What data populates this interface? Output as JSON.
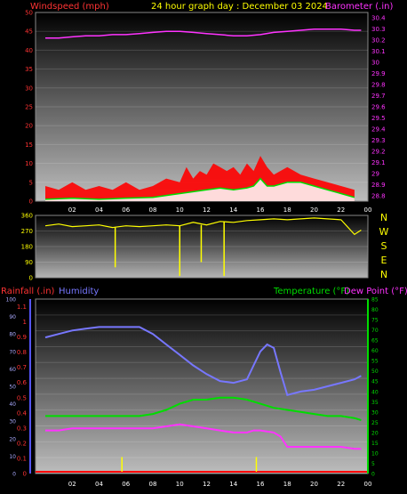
{
  "header": {
    "left_label": "Windspeed (mph)",
    "center_label": "24 hour graph day : December 03 2024",
    "right_label": "Barometer (.in)"
  },
  "bottom_header": {
    "rainfall_label": "Rainfall (.in)",
    "humidity_label": "Humidity",
    "temperature_label": "Temperature (°F)",
    "dewpoint_label": "Dew Point (°F)"
  },
  "direction_letters": [
    "N",
    "W",
    "S",
    "E",
    "N"
  ],
  "colors": {
    "wind": "#ff0000",
    "wind_avg": "#ffffff",
    "wind_green": "#00dd00",
    "barometer": "#ff33ff",
    "direction": "#ffff00",
    "humidity": "#7777ff",
    "temperature": "#00dd00",
    "dewpoint": "#ff33ff",
    "rain": "#ffff00",
    "axis_red": "#ff3333",
    "axis_pink": "#ff33ff",
    "axis_green": "#00dd00",
    "axis_blue": "#5555ff"
  },
  "chart_data": [
    {
      "type": "line",
      "x_ticks": [
        "02",
        "04",
        "06",
        "08",
        "10",
        "12",
        "14",
        "16",
        "18",
        "20",
        "22",
        "00"
      ],
      "y_left_ticks": [
        "0",
        "5",
        "10",
        "15",
        "20",
        "25",
        "30",
        "35",
        "40",
        "45",
        "50"
      ],
      "y_right_ticks": [
        "28.8",
        "28.9",
        "29",
        "29.1",
        "29.2",
        "29.3",
        "29.4",
        "29.5",
        "29.6",
        "29.7",
        "29.8",
        "29.9",
        "30",
        "30.1",
        "30.2",
        "30.3",
        "30.4"
      ],
      "ylim_left": [
        0,
        50
      ],
      "ylim_right": [
        28.75,
        30.45
      ],
      "series": [
        {
          "key": "wind_gust",
          "x": [
            0,
            1,
            2,
            3,
            4,
            5,
            6,
            7,
            8,
            9,
            10,
            10.5,
            11,
            11.5,
            12,
            12.5,
            13,
            13.5,
            14,
            14.5,
            15,
            15.5,
            16,
            16.5,
            17,
            18,
            19,
            20,
            21,
            22,
            23
          ],
          "values": [
            4,
            3,
            5,
            3,
            4,
            3,
            5,
            3,
            4,
            6,
            5,
            9,
            6,
            8,
            7,
            10,
            9,
            8,
            9,
            7,
            10,
            8,
            12,
            9,
            7,
            9,
            7,
            6,
            5,
            4,
            3
          ]
        },
        {
          "key": "wind_avg",
          "x": [
            0,
            2,
            4,
            6,
            8,
            9,
            10,
            11,
            12,
            13,
            14,
            15,
            15.5,
            16,
            16.5,
            17,
            18,
            19,
            20,
            21,
            22,
            23
          ],
          "values": [
            0.5,
            0.8,
            0.5,
            0.8,
            1,
            1.5,
            2,
            2.5,
            3,
            3.5,
            3,
            3.5,
            4,
            6,
            4,
            4,
            5,
            5,
            4,
            3,
            2,
            1
          ]
        },
        {
          "key": "barometer",
          "x": [
            0,
            1,
            2,
            3,
            4,
            5,
            6,
            7,
            8,
            9,
            10,
            11,
            12,
            13,
            14,
            15,
            16,
            17,
            18,
            19,
            20,
            21,
            22,
            23,
            23.5
          ],
          "values": [
            30.22,
            30.22,
            30.23,
            30.24,
            30.24,
            30.25,
            30.25,
            30.26,
            30.27,
            30.28,
            30.28,
            30.27,
            30.26,
            30.25,
            30.24,
            30.24,
            30.25,
            30.27,
            30.28,
            30.29,
            30.3,
            30.3,
            30.3,
            30.29,
            30.29
          ]
        }
      ]
    },
    {
      "type": "line",
      "x_ticks": [
        "02",
        "04",
        "06",
        "08",
        "10",
        "12",
        "14",
        "16",
        "18",
        "20",
        "22",
        "00"
      ],
      "y_left_ticks": [
        "0",
        "90",
        "180",
        "270",
        "360"
      ],
      "ylim": [
        0,
        360
      ],
      "series": [
        {
          "key": "direction",
          "x": [
            0,
            1,
            2,
            3,
            4,
            5,
            6,
            7,
            8,
            9,
            10,
            11,
            12,
            13,
            14,
            15,
            16,
            17,
            18,
            19,
            20,
            21,
            22,
            23,
            23.5
          ],
          "values": [
            300,
            310,
            295,
            300,
            305,
            290,
            300,
            295,
            300,
            305,
            300,
            320,
            305,
            325,
            320,
            330,
            335,
            340,
            335,
            340,
            345,
            340,
            335,
            250,
            275
          ]
        }
      ],
      "spikes": [
        {
          "x": 5.2,
          "value": 60
        },
        {
          "x": 10,
          "value": 10
        },
        {
          "x": 11.6,
          "value": 90
        },
        {
          "x": 13.3,
          "value": 10
        }
      ]
    },
    {
      "type": "line",
      "x_ticks": [
        "02",
        "04",
        "06",
        "08",
        "10",
        "12",
        "14",
        "16",
        "18",
        "20",
        "22",
        "00"
      ],
      "y_left_ticks": [
        "0",
        "0.1",
        "0.2",
        "0.3",
        "0.4",
        "0.5",
        "0.6",
        "0.7",
        "0.8",
        "0.9",
        "1",
        "1.1"
      ],
      "y_left2_ticks": [
        "0",
        "10",
        "20",
        "30",
        "40",
        "50",
        "60",
        "70",
        "80",
        "90",
        "100"
      ],
      "y_right_ticks": [
        "0",
        "5",
        "10",
        "15",
        "20",
        "25",
        "30",
        "35",
        "40",
        "45",
        "50",
        "55",
        "60",
        "65",
        "70",
        "75",
        "80",
        "85"
      ],
      "ylim_humidity": [
        0,
        100
      ],
      "ylim_temp": [
        0,
        85
      ],
      "series": [
        {
          "key": "humidity",
          "x": [
            0,
            1,
            2,
            3,
            4,
            5,
            6,
            7,
            8,
            9,
            10,
            11,
            12,
            13,
            14,
            15,
            15.5,
            16,
            16.5,
            17,
            17.5,
            18,
            19,
            20,
            21,
            22,
            23,
            23.5
          ],
          "values": [
            78,
            80,
            82,
            83,
            84,
            84,
            84,
            84,
            80,
            74,
            68,
            62,
            57,
            53,
            52,
            54,
            62,
            70,
            74,
            72,
            58,
            45,
            47,
            48,
            50,
            52,
            54,
            56
          ]
        },
        {
          "key": "temperature",
          "x": [
            0,
            1,
            2,
            3,
            4,
            5,
            6,
            7,
            8,
            9,
            10,
            11,
            12,
            13,
            14,
            15,
            16,
            17,
            18,
            19,
            20,
            21,
            22,
            23,
            23.5
          ],
          "values": [
            28,
            28,
            28,
            28,
            28,
            28,
            28,
            28,
            29,
            31,
            34,
            36,
            36,
            37,
            37,
            36,
            34,
            32,
            31,
            30,
            29,
            28,
            28,
            27,
            26
          ]
        },
        {
          "key": "dewpoint",
          "x": [
            0,
            1,
            2,
            3,
            4,
            5,
            6,
            7,
            8,
            9,
            10,
            11,
            12,
            13,
            14,
            15,
            15.5,
            16,
            17,
            17.5,
            18,
            19,
            20,
            21,
            22,
            23,
            23.5
          ],
          "values": [
            21,
            21,
            22,
            22,
            22,
            22,
            22,
            22,
            22,
            23,
            24,
            23,
            22,
            21,
            20,
            20,
            21,
            21,
            20,
            18,
            13,
            13,
            13,
            13,
            13,
            12,
            12
          ]
        }
      ],
      "rain_ticks": [
        {
          "x": 5.7,
          "value": 0.05
        },
        {
          "x": 15.7,
          "value": 0.05
        }
      ]
    }
  ]
}
